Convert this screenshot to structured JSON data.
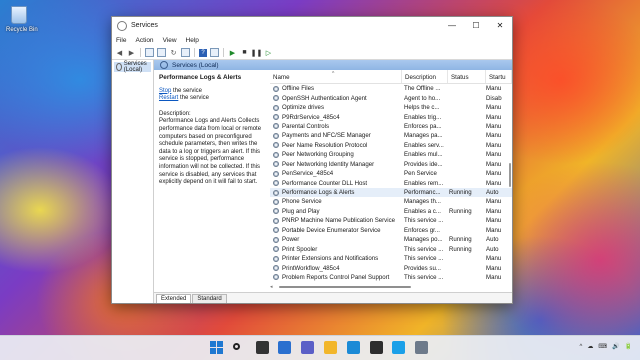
{
  "desktop": {
    "recycle_bin_label": "Recycle Bin"
  },
  "window": {
    "title": "Services",
    "controls": {
      "minimize": "—",
      "maximize": "☐",
      "close": "✕"
    },
    "menu": [
      "File",
      "Action",
      "View",
      "Help"
    ],
    "toolbar_icons": [
      "back-icon",
      "forward-icon",
      "show-tree-icon",
      "properties-icon",
      "refresh-icon",
      "export-icon",
      "help-icon",
      "console-icon",
      "start-service-icon",
      "stop-service-icon",
      "pause-service-icon",
      "restart-service-icon"
    ],
    "tree": {
      "root_label": "Services (Local)"
    },
    "panel_header": "Services (Local)",
    "detail": {
      "service_title": "Performance Logs & Alerts",
      "stop_link": "Stop",
      "stop_suffix": " the service",
      "restart_link": "Restart",
      "restart_suffix": " the service",
      "description_label": "Description:",
      "description": "Performance Logs and Alerts Collects performance data from local or remote computers based on preconfigured schedule parameters, then writes the data to a log or triggers an alert. If this service is stopped, performance information will not be collected. If this service is disabled, any services that explicitly depend on it will fail to start."
    },
    "columns": {
      "name": "Name",
      "description": "Description",
      "status": "Status",
      "startup": "Startu"
    },
    "services": [
      {
        "name": "Offline Files",
        "description": "The Offline ...",
        "status": "",
        "startup": "Manu"
      },
      {
        "name": "OpenSSH Authentication Agent",
        "description": "Agent to ho...",
        "status": "",
        "startup": "Disab"
      },
      {
        "name": "Optimize drives",
        "description": "Helps the c...",
        "status": "",
        "startup": "Manu"
      },
      {
        "name": "P9RdrService_485c4",
        "description": "Enables trig...",
        "status": "",
        "startup": "Manu"
      },
      {
        "name": "Parental Controls",
        "description": "Enforces pa...",
        "status": "",
        "startup": "Manu"
      },
      {
        "name": "Payments and NFC/SE Manager",
        "description": "Manages pa...",
        "status": "",
        "startup": "Manu"
      },
      {
        "name": "Peer Name Resolution Protocol",
        "description": "Enables serv...",
        "status": "",
        "startup": "Manu"
      },
      {
        "name": "Peer Networking Grouping",
        "description": "Enables mul...",
        "status": "",
        "startup": "Manu"
      },
      {
        "name": "Peer Networking Identity Manager",
        "description": "Provides ide...",
        "status": "",
        "startup": "Manu"
      },
      {
        "name": "PenService_485c4",
        "description": "Pen Service",
        "status": "",
        "startup": "Manu"
      },
      {
        "name": "Performance Counter DLL Host",
        "description": "Enables rem...",
        "status": "",
        "startup": "Manu"
      },
      {
        "name": "Performance Logs & Alerts",
        "description": "Performanc...",
        "status": "Running",
        "startup": "Auto"
      },
      {
        "name": "Phone Service",
        "description": "Manages th...",
        "status": "",
        "startup": "Manu"
      },
      {
        "name": "Plug and Play",
        "description": "Enables a c...",
        "status": "Running",
        "startup": "Manu"
      },
      {
        "name": "PNRP Machine Name Publication Service",
        "description": "This service ...",
        "status": "",
        "startup": "Manu"
      },
      {
        "name": "Portable Device Enumerator Service",
        "description": "Enforces gr...",
        "status": "",
        "startup": "Manu"
      },
      {
        "name": "Power",
        "description": "Manages po...",
        "status": "Running",
        "startup": "Auto"
      },
      {
        "name": "Print Spooler",
        "description": "This service ...",
        "status": "Running",
        "startup": "Auto"
      },
      {
        "name": "Printer Extensions and Notifications",
        "description": "This service ...",
        "status": "",
        "startup": "Manu"
      },
      {
        "name": "PrintWorkflow_485c4",
        "description": "Provides su...",
        "status": "",
        "startup": "Manu"
      },
      {
        "name": "Problem Reports Control Panel Support",
        "description": "This service ...",
        "status": "",
        "startup": "Manu"
      }
    ],
    "tabs": [
      "Extended",
      "Standard"
    ]
  },
  "taskbar": {
    "icons": [
      "start-icon",
      "search-icon",
      "task-view-icon",
      "widgets-icon",
      "chat-icon",
      "file-explorer-icon",
      "edge-icon",
      "store-icon",
      "skype-icon",
      "services-icon"
    ],
    "icon_colors": [
      "#1f78d1",
      "#222222",
      "#333333",
      "#2a6fcf",
      "#5b5fc7",
      "#f2b62b",
      "#1b8ad6",
      "#2d2d2d",
      "#1aa0e8",
      "#6d7a8a"
    ],
    "tray": [
      "^",
      "☁",
      "⌨",
      "🔊",
      "🔋"
    ]
  }
}
